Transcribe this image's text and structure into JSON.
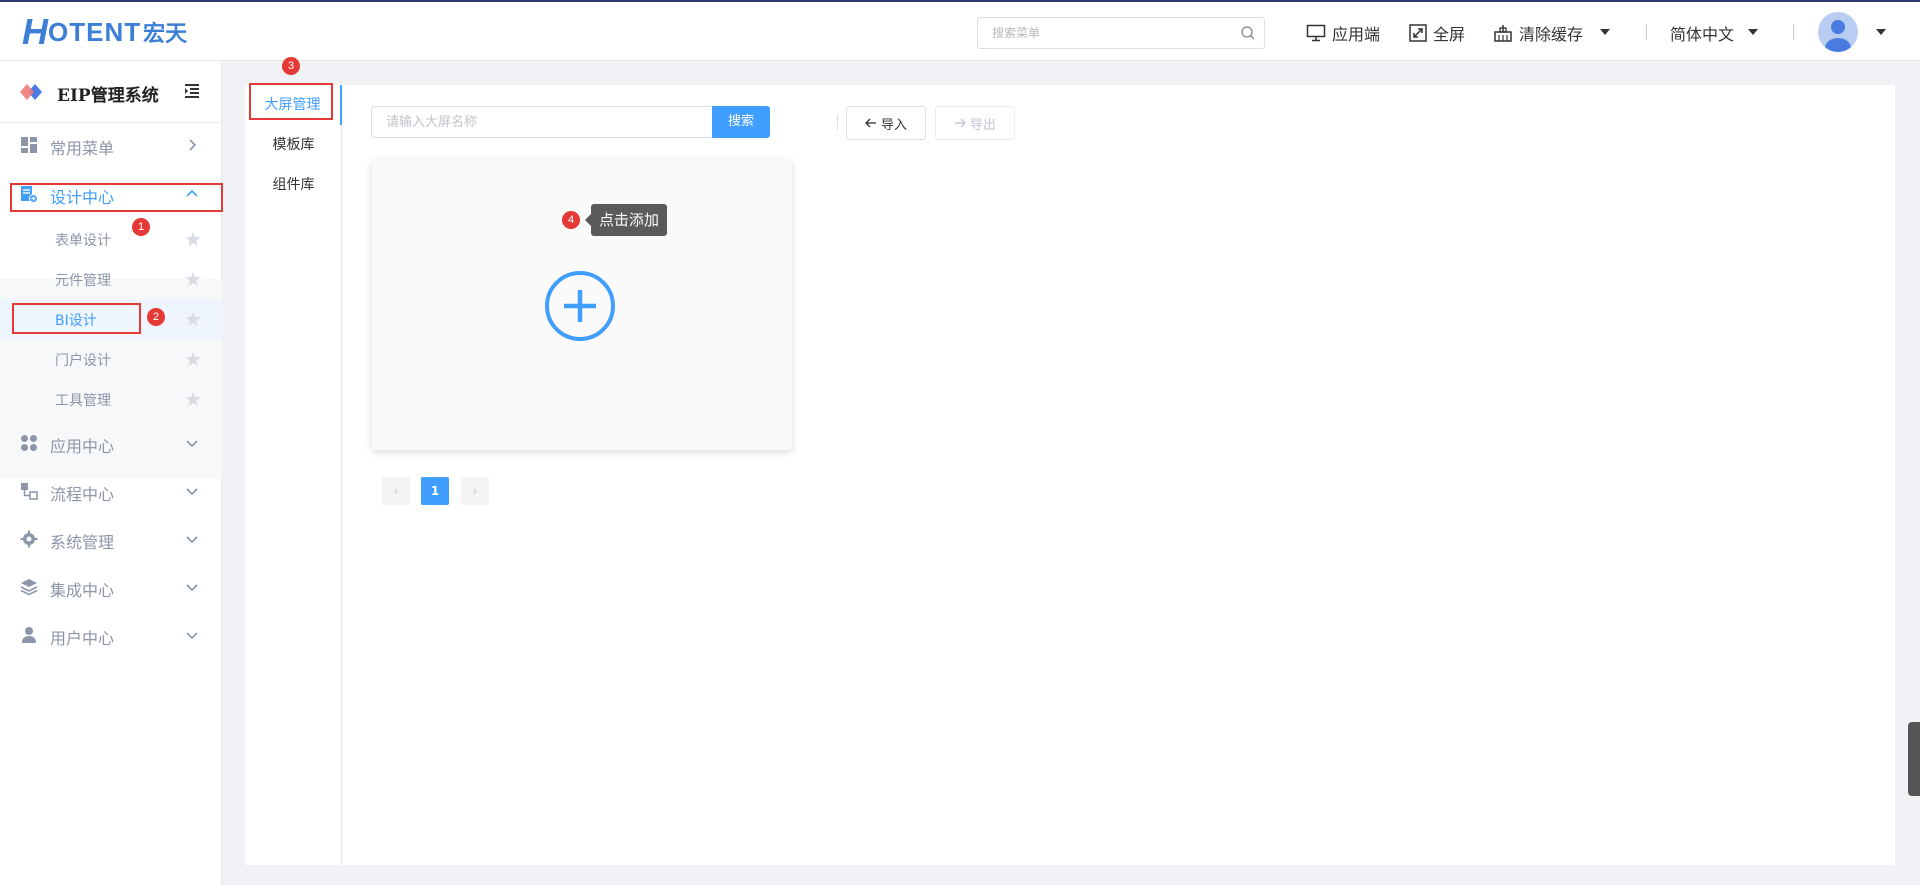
{
  "header": {
    "logo_letter": "H",
    "logo_text": "OTENT",
    "logo_cn": "宏天",
    "search_placeholder": "搜索菜单",
    "app_label": "应用端",
    "fullscreen_label": "全屏",
    "clear_cache_label": "清除缓存",
    "language_label": "简体中文"
  },
  "sidebar": {
    "system_title": "EIP管理系统",
    "menus": [
      {
        "label": "常用菜单",
        "icon": "dashboard-icon"
      },
      {
        "label": "设计中心",
        "icon": "design-doc-icon"
      },
      {
        "label": "应用中心",
        "icon": "apps-icon"
      },
      {
        "label": "流程中心",
        "icon": "flow-icon"
      },
      {
        "label": "系统管理",
        "icon": "gear-icon"
      },
      {
        "label": "集成中心",
        "icon": "layers-icon"
      },
      {
        "label": "用户中心",
        "icon": "user-icon"
      }
    ],
    "submenus": [
      {
        "label": "表单设计"
      },
      {
        "label": "元件管理"
      },
      {
        "label": "BI设计"
      },
      {
        "label": "门户设计"
      },
      {
        "label": "工具管理"
      }
    ]
  },
  "tabs": [
    {
      "label": "大屏管理"
    },
    {
      "label": "模板库"
    },
    {
      "label": "组件库"
    }
  ],
  "toolbar": {
    "search_placeholder": "请输入大屏名称",
    "search_button": "搜索",
    "import_label": "导入",
    "export_label": "导出"
  },
  "card": {
    "tooltip": "点击添加"
  },
  "pagination": {
    "current_page": "1",
    "prev": "‹",
    "next": "›"
  },
  "annotations": [
    "1",
    "2",
    "3",
    "4"
  ],
  "colors": {
    "primary": "#409eff",
    "annotation": "#e53935",
    "logo": "#3c7fd6"
  }
}
